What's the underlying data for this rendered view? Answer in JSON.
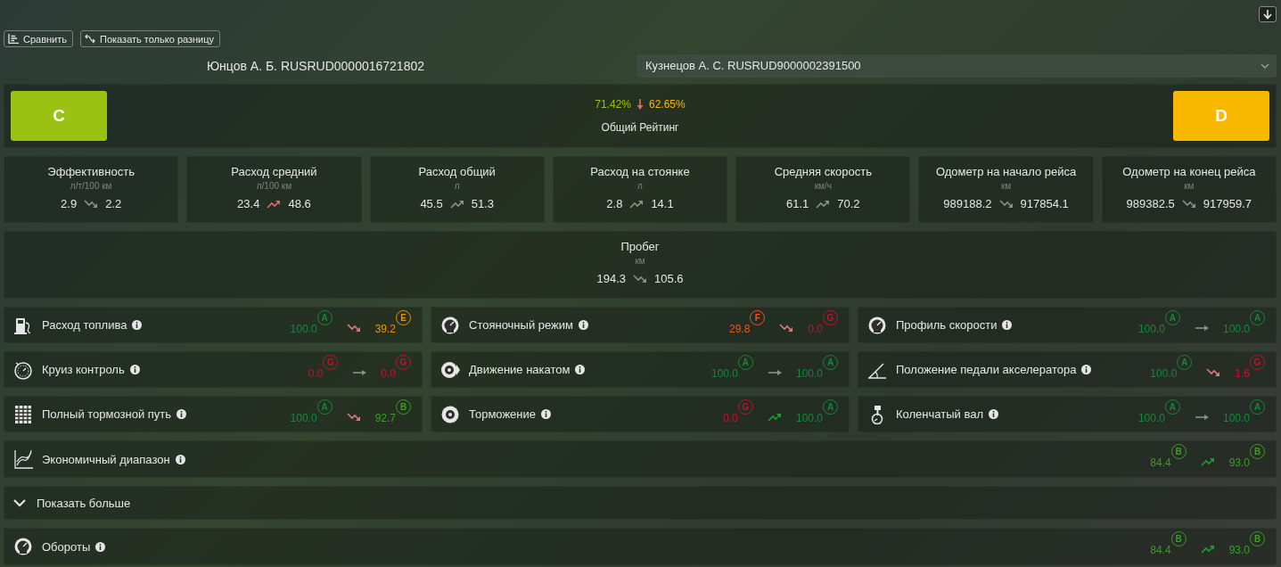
{
  "toolbar": {
    "compare_button": "Сравнить",
    "diff_button": "Показать только разницу"
  },
  "drivers": {
    "left": "Юнцов А. Б. RUSRUD0000016721802",
    "right_select": "Кузнецов А. С. RUSRUD9000002391500"
  },
  "rating": {
    "left_grade": {
      "letter": "C",
      "color": "#9bc112"
    },
    "right_grade": {
      "letter": "D",
      "color": "#f9b800"
    },
    "left_value": {
      "text": "71.42%",
      "color": "#9bc112"
    },
    "right_value": {
      "text": "62.65%",
      "color": "#f9b800"
    },
    "trend": {
      "kind": "down",
      "color": "#e06a6a"
    },
    "title": "Общий Рейтинг"
  },
  "metrics": [
    {
      "title": "Эффективность",
      "unit": "л/т/100 км",
      "a": "2.9",
      "b": "2.2",
      "trend": {
        "kind": "down",
        "color": "#8a8f8b"
      }
    },
    {
      "title": "Расход средний",
      "unit": "л/100 км",
      "a": "23.4",
      "b": "48.6",
      "trend": {
        "kind": "up",
        "color": "#e06a6a"
      }
    },
    {
      "title": "Расход общий",
      "unit": "л",
      "a": "45.5",
      "b": "51.3",
      "trend": {
        "kind": "up",
        "color": "#8a8f8b"
      }
    },
    {
      "title": "Расход на стоянке",
      "unit": "л",
      "a": "2.8",
      "b": "14.1",
      "trend": {
        "kind": "up",
        "color": "#8a8f8b"
      }
    },
    {
      "title": "Средняя скорость",
      "unit": "км/ч",
      "a": "61.1",
      "b": "70.2",
      "trend": {
        "kind": "up",
        "color": "#8a8f8b"
      }
    },
    {
      "title": "Одометр на начало рейса",
      "unit": "км",
      "a": "989188.2",
      "b": "917854.1",
      "trend": {
        "kind": "down",
        "color": "#8a8f8b"
      }
    },
    {
      "title": "Одометр на конец рейса",
      "unit": "км",
      "a": "989382.5",
      "b": "917959.7",
      "trend": {
        "kind": "down",
        "color": "#8a8f8b"
      }
    }
  ],
  "mileage": {
    "title": "Пробег",
    "unit": "км",
    "a": "194.3",
    "b": "105.6",
    "trend": {
      "kind": "down",
      "color": "#8a8f8b"
    }
  },
  "scores": [
    {
      "kind": "fuel",
      "label": "Расход топлива",
      "a": {
        "value": "100.0",
        "grade": "A",
        "color": "#15883a"
      },
      "trend": {
        "kind": "down",
        "color": "#e07a7a"
      },
      "b": {
        "value": "39.2",
        "grade": "E",
        "color": "#e8930c"
      }
    },
    {
      "kind": "gauge",
      "label": "Стояночный режим",
      "a": {
        "value": "29.8",
        "grade": "F",
        "color": "#e85a1a"
      },
      "trend": {
        "kind": "down",
        "color": "#e07a7a"
      },
      "b": {
        "value": "0.0",
        "grade": "G",
        "color": "#c8102e"
      }
    },
    {
      "kind": "gauge",
      "label": "Профиль скорости",
      "a": {
        "value": "100.0",
        "grade": "A",
        "color": "#15883a"
      },
      "trend": {
        "kind": "flat",
        "color": "#8a8f8b"
      },
      "b": {
        "value": "100.0",
        "grade": "A",
        "color": "#15883a"
      }
    },
    {
      "kind": "cruise",
      "label": "Круиз контроль",
      "a": {
        "value": "0.0",
        "grade": "G",
        "color": "#c8102e"
      },
      "trend": {
        "kind": "flat",
        "color": "#8a8f8b"
      },
      "b": {
        "value": "0.0",
        "grade": "G",
        "color": "#c8102e"
      }
    },
    {
      "kind": "wheel",
      "label": "Движение накатом",
      "a": {
        "value": "100.0",
        "grade": "A",
        "color": "#15883a"
      },
      "trend": {
        "kind": "flat",
        "color": "#8a8f8b"
      },
      "b": {
        "value": "100.0",
        "grade": "A",
        "color": "#15883a"
      }
    },
    {
      "kind": "pedal",
      "label": "Положение педали акселератора",
      "a": {
        "value": "100.0",
        "grade": "A",
        "color": "#15883a"
      },
      "trend": {
        "kind": "down",
        "color": "#e07a7a"
      },
      "b": {
        "value": "1.6",
        "grade": "G",
        "color": "#c8102e"
      }
    },
    {
      "kind": "tread",
      "label": "Полный тормозной путь",
      "a": {
        "value": "100.0",
        "grade": "A",
        "color": "#15883a"
      },
      "trend": {
        "kind": "down",
        "color": "#e07a7a"
      },
      "b": {
        "value": "92.7",
        "grade": "B",
        "color": "#3f9a2a"
      }
    },
    {
      "kind": "disc",
      "label": "Торможение",
      "a": {
        "value": "0.0",
        "grade": "G",
        "color": "#c8102e"
      },
      "trend": {
        "kind": "up",
        "color": "#18a030"
      },
      "b": {
        "value": "100.0",
        "grade": "A",
        "color": "#15883a"
      }
    },
    {
      "kind": "crank",
      "label": "Коленчатый вал",
      "a": {
        "value": "100.0",
        "grade": "A",
        "color": "#15883a"
      },
      "trend": {
        "kind": "flat",
        "color": "#8a8f8b"
      },
      "b": {
        "value": "100.0",
        "grade": "A",
        "color": "#15883a"
      }
    }
  ],
  "economy": {
    "kind": "chart",
    "label": "Экономичный диапазон",
    "a": {
      "value": "84.4",
      "grade": "B",
      "color": "#3f9a2a"
    },
    "trend": {
      "kind": "up",
      "color": "#18a030"
    },
    "b": {
      "value": "93.0",
      "grade": "B",
      "color": "#3f9a2a"
    }
  },
  "show_more": {
    "label": "Показать больше",
    "expanded": false
  },
  "rpm": {
    "kind": "gauge",
    "label": "Обороты",
    "a": {
      "value": "84.4",
      "grade": "B",
      "color": "#3f9a2a"
    },
    "trend": {
      "kind": "up",
      "color": "#18a030"
    },
    "b": {
      "value": "93.0",
      "grade": "B",
      "color": "#3f9a2a"
    }
  }
}
